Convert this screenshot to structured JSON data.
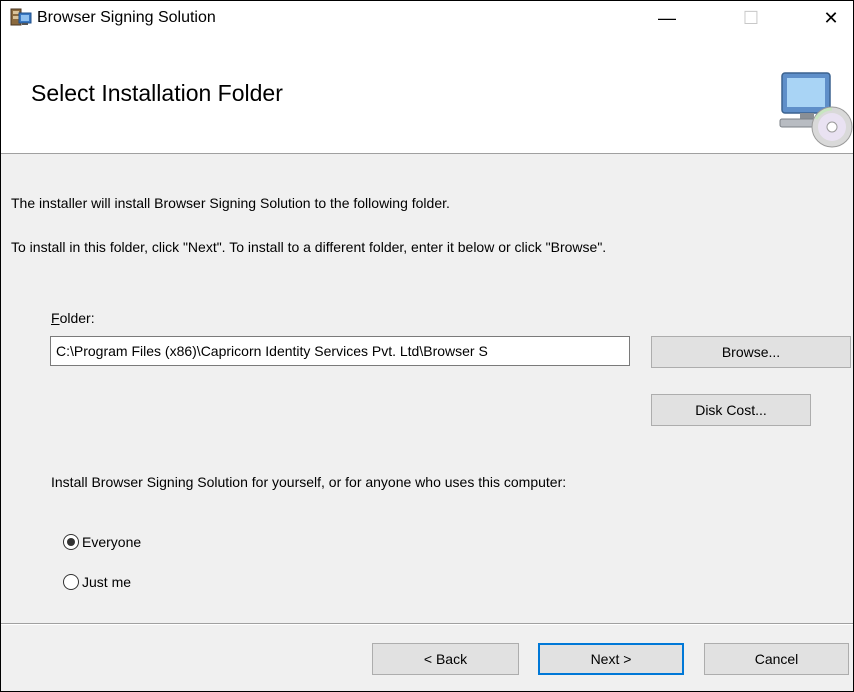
{
  "window": {
    "title": "Browser Signing Solution",
    "controls": {
      "minimize": "—",
      "maximize": "☐",
      "close": "✕"
    }
  },
  "header": {
    "title": "Select Installation Folder",
    "icon": "computer-cd-icon"
  },
  "body": {
    "intro_line1": "The installer will install Browser Signing Solution to the following folder.",
    "intro_line2": "To install in this folder, click \"Next\". To install to a different folder, enter it below or click \"Browse\".",
    "folder_label_mnemonic": "F",
    "folder_label_rest": "older:",
    "folder_value": "C:\\Program Files (x86)\\Capricorn Identity Services Pvt. Ltd\\Browser S",
    "browse_label": "Browse...",
    "disk_cost_label": "Disk Cost...",
    "scope_text": "Install Browser Signing Solution for yourself, or for anyone who uses this computer:",
    "radio_everyone": "Everyone",
    "radio_just_me": "Just me",
    "selected_scope": "Everyone"
  },
  "footer": {
    "back_label": "< Back",
    "next_label": "Next >",
    "cancel_label": "Cancel"
  },
  "colors": {
    "dialog_bg": "#f0f0f0",
    "header_bg": "#ffffff",
    "button_bg": "#e1e1e1",
    "default_button_border": "#0078d7"
  }
}
